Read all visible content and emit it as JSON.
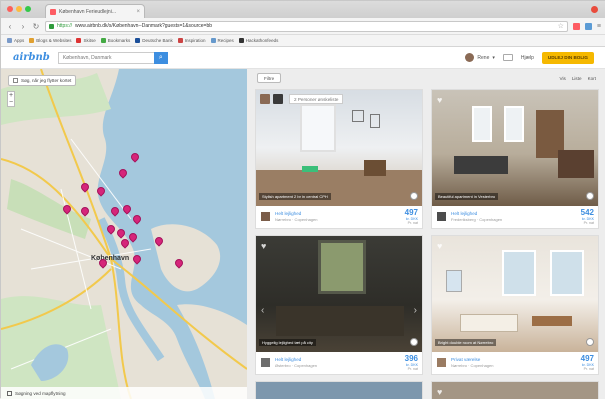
{
  "browser": {
    "tab_title": "København Ferieudlejni...",
    "url_scheme": "https://",
    "url": "www.airbnb.dk/s/København--Danmark?guests=1&source=bb",
    "bookmarks": [
      "Apps",
      "Blogs & Websites",
      "Skitse",
      "Bookmarks",
      "Deutsche Bank",
      "Inspiration",
      "Recipes",
      "Hackathonfeeds"
    ]
  },
  "header": {
    "logo": "airbnb",
    "search_value": "København, Danmark",
    "user_name": "Rene",
    "help": "Hjælp",
    "host_button": "UDLEJ DIN BOLIG"
  },
  "map": {
    "search_checkbox": "Søg, når jeg flytter kortet",
    "city_label": "København",
    "footer": "Søgning ved mapflytning",
    "pin_count": 17
  },
  "results": {
    "filter_button": "Filtre",
    "view_options": [
      "Vis",
      "Liste",
      "Kort"
    ],
    "wishlist_pill": "2 Personer ønskeliste",
    "listings": [
      {
        "caption": "Stylish apartment 2 br in central CPH",
        "title": "Helt lejlighed",
        "sub": "Nørrebro · Copenhagen",
        "price": "497",
        "currency": "kr. DKK",
        "per": "Pr. nat"
      },
      {
        "caption": "Beautiful apartment in Vesterbro",
        "title": "Helt lejlighed",
        "sub": "Frederiksberg · Copenhagen",
        "price": "542",
        "currency": "kr. DKK",
        "per": "Pr. nat"
      },
      {
        "caption": "Hyggelig lejlighed tæt på city",
        "title": "Helt lejlighed",
        "sub": "Østerbro · Copenhagen",
        "price": "396",
        "currency": "kr. DKK",
        "per": "Pr. nat"
      },
      {
        "caption": "Bright double room at Nørrebro",
        "title": "Privat værelse",
        "sub": "Nørrebro · Copenhagen",
        "price": "497",
        "currency": "kr. DKK",
        "per": "Pr. nat"
      }
    ]
  },
  "colors": {
    "brand_blue": "#3d8ee0",
    "host_yellow": "#f5b800",
    "pin_pink": "#d6257a"
  }
}
